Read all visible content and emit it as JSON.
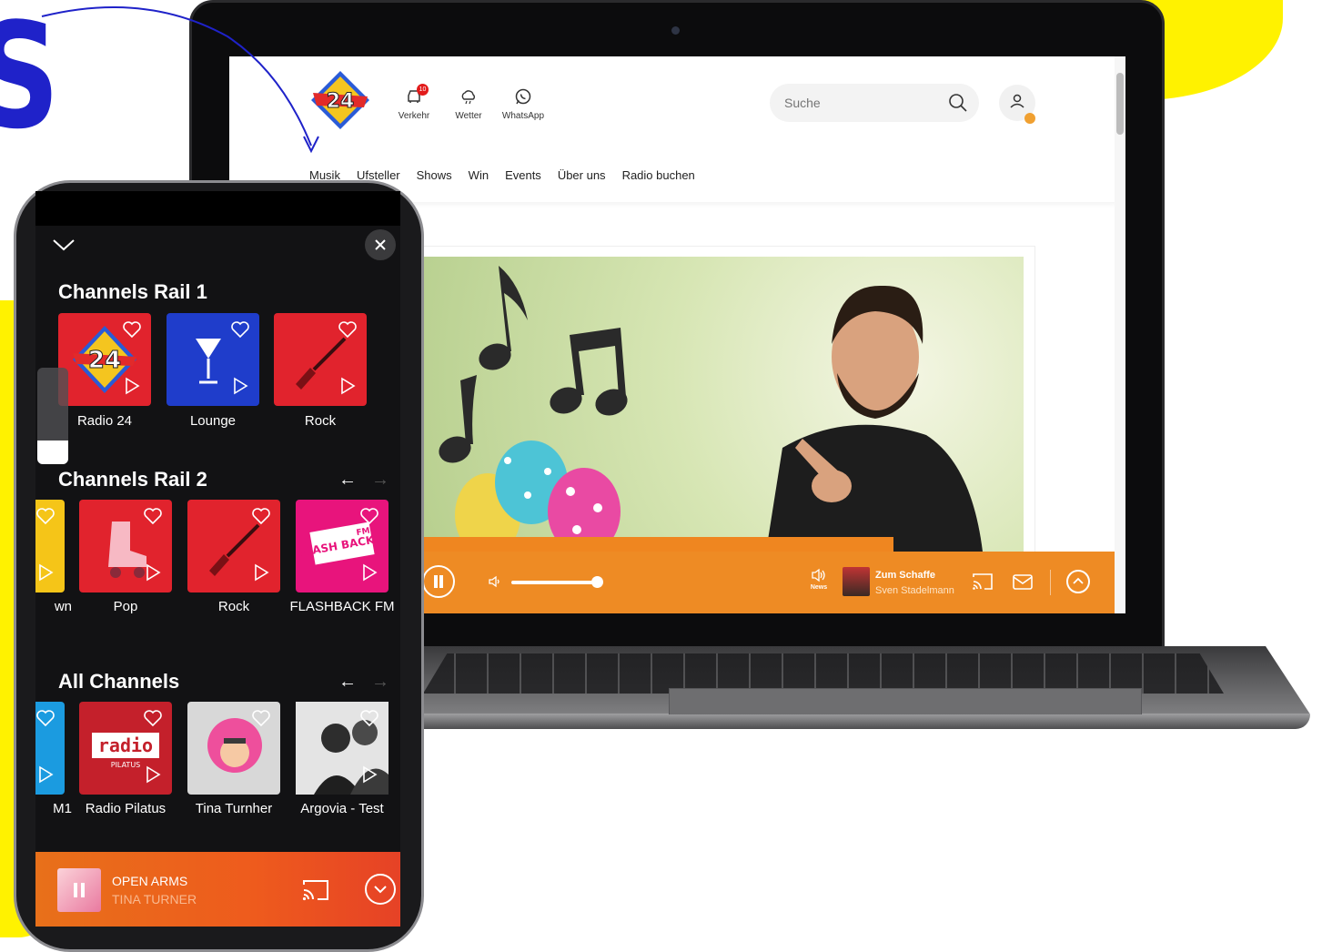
{
  "promo": {
    "big_letter": "S"
  },
  "website": {
    "header": {
      "traffic_label": "Verkehr",
      "traffic_badge": "10",
      "weather_label": "Wetter",
      "whatsapp_label": "WhatsApp",
      "search_placeholder": "Suche"
    },
    "nav": [
      "Musik",
      "Ufsteller",
      "Shows",
      "Win",
      "Events",
      "Über uns",
      "Radio buchen"
    ],
    "player": {
      "news_label": "News",
      "show_title": "Zum Schaffe",
      "host": "Sven Stadelmann",
      "volume": 0.9
    }
  },
  "phone": {
    "sections": [
      {
        "title": "Channels Rail 1",
        "tiles": [
          {
            "label": "Radio 24",
            "color": "#e1232d"
          },
          {
            "label": "Lounge",
            "color": "#1f3dcb"
          },
          {
            "label": "Rock",
            "color": "#e1232d"
          }
        ]
      },
      {
        "title": "Channels Rail 2",
        "tiles": [
          {
            "label": "wn",
            "color": "#f5c518"
          },
          {
            "label": "Pop",
            "color": "#e1232d"
          },
          {
            "label": "Rock",
            "color": "#e1232d"
          },
          {
            "label": "FLASHBACK FM",
            "color": "#e8147c"
          }
        ]
      },
      {
        "title": "All Channels",
        "tiles": [
          {
            "label": "M1",
            "color": "#1b9be0"
          },
          {
            "label": "Radio Pilatus",
            "color": "#c4202b"
          },
          {
            "label": "Tina Turnher",
            "color": "#d8d8d8"
          },
          {
            "label": "Argovia - Test",
            "color": "#bdbdbd"
          }
        ]
      }
    ],
    "logo_text": "24",
    "pilatus_logo": "radio",
    "pilatus_sub": "PILATUS",
    "flashback_logo": "FLASH BACK",
    "flashback_fm": "FM",
    "now_playing": {
      "title": "OPEN ARMS",
      "artist": "TINA TURNER"
    },
    "colors": {
      "accent": "#ee8b24",
      "player_red": "#e64226"
    }
  }
}
